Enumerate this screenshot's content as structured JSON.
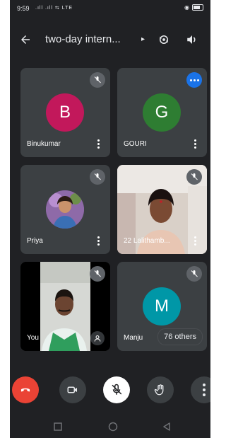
{
  "status_bar": {
    "time": "9:59",
    "icons_text": ".ıll .ıll ⇆ LTE"
  },
  "top_bar": {
    "title": "two-day intern...",
    "title_arrow": "▸"
  },
  "participants": [
    {
      "name": "Binukumar",
      "initial": "B",
      "avatar_color": "#c2185b",
      "muted": true
    },
    {
      "name": "GOURI",
      "initial": "G",
      "avatar_color": "#2e7d32",
      "speaking": true
    },
    {
      "name": "Priya",
      "muted": true
    },
    {
      "name": "22 Lalithamb...",
      "muted": true
    },
    {
      "name": "You",
      "muted": true
    },
    {
      "name": "Manju",
      "initial": "M",
      "avatar_color": "#0097a7",
      "muted": true
    }
  ],
  "others_count": "76 others",
  "colors": {
    "background": "#202124",
    "tile": "#3c4043",
    "end_call": "#ea4335",
    "accent_blue": "#1a73e8"
  }
}
